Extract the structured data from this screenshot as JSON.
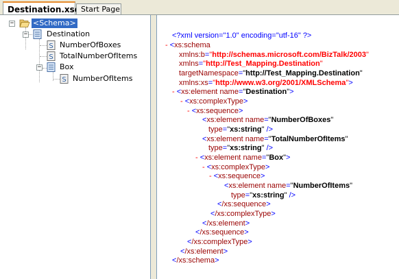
{
  "tabs": [
    {
      "label": "Destination.xsd",
      "active": true
    },
    {
      "label": "Start Page",
      "active": false
    }
  ],
  "tree": {
    "schema_label": "<Schema>",
    "destination_label": "Destination",
    "number_of_boxes_label": "NumberOfBoxes",
    "total_number_of_items_label": "TotalNumberOfItems",
    "box_label": "Box",
    "number_of_items_label": "NumberOfItems"
  },
  "xml": {
    "l1": "<?xml version=\"1.0\" encoding=\"utf-16\" ?>",
    "l2_tag": "xs:schema",
    "l3_attr": "xmlns:b",
    "l3_val": "http://schemas.microsoft.com/BizTalk/2003",
    "l4_attr": "xmlns",
    "l4_val": "http://Test_Mapping.Destination",
    "l5_attr": "targetNamespace",
    "l5_val": "http://Test_Mapping.Destination",
    "l6_attr": "xmlns:xs",
    "l6_val": "http://www.w3.org/2001/XMLSchema",
    "l7_tag": "xs:element",
    "l7_attr": "name",
    "l7_val": "Destination",
    "l8_tag": "xs:complexType",
    "l9_tag": "xs:sequence",
    "l10_tag": "xs:element",
    "l10_attr": "name",
    "l10_val": "NumberOfBoxes",
    "l11_attr": "type",
    "l11_val": "xs:string",
    "l12_tag": "xs:element",
    "l12_attr": "name",
    "l12_val": "TotalNumberOfItems",
    "l13_attr": "type",
    "l13_val": "xs:string",
    "l14_tag": "xs:element",
    "l14_attr": "name",
    "l14_val": "Box",
    "l15_tag": "xs:complexType",
    "l16_tag": "xs:sequence",
    "l17_tag": "xs:element",
    "l17_attr": "name",
    "l17_val": "NumberOfItems",
    "l18_attr": "type",
    "l18_val": "xs:string",
    "l19_tag": "/xs:sequence",
    "l20_tag": "/xs:complexType",
    "l21_tag": "/xs:element",
    "l22_tag": "/xs:sequence",
    "l23_tag": "/xs:complexType",
    "l24_tag": "/xs:element",
    "l25_tag": "/xs:schema"
  },
  "colors": {
    "selection": "#316ac5",
    "xml_tag": "#990000",
    "xml_bracket": "#0000ff",
    "xml_attr": "#ff0000",
    "tab_accent": "#e68b2c"
  }
}
